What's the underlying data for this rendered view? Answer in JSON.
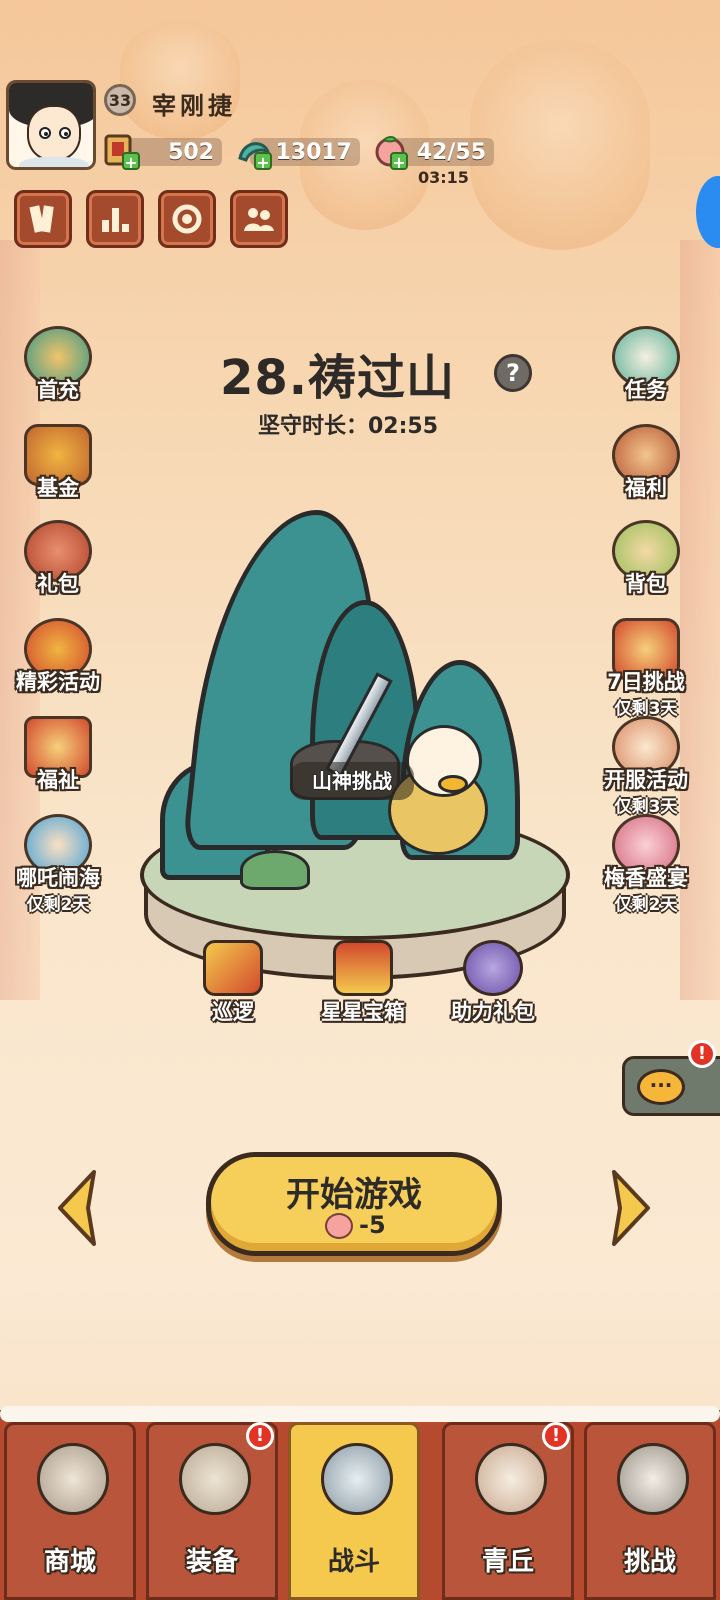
{
  "player": {
    "level": "33",
    "name": "宰刚捷"
  },
  "resources": {
    "scrolls": "502",
    "jade": "13017",
    "stamina": "42/55",
    "stamina_timer": "03:15"
  },
  "top_buttons": [
    {
      "icon": "cards-icon"
    },
    {
      "icon": "ranking-icon"
    },
    {
      "icon": "settings-icon"
    },
    {
      "icon": "friends-icon"
    }
  ],
  "stage": {
    "title": "28.祷过山",
    "hold_time": "坚守时长：02:55",
    "challenge_label": "山神挑战"
  },
  "left_menu": [
    {
      "label": "首充",
      "sub": ""
    },
    {
      "label": "基金",
      "sub": ""
    },
    {
      "label": "礼包",
      "sub": ""
    },
    {
      "label": "精彩活动",
      "sub": ""
    },
    {
      "label": "福祉",
      "sub": ""
    },
    {
      "label": "哪吒闹海",
      "sub": "仅剩2天"
    }
  ],
  "right_menu": [
    {
      "label": "任务",
      "sub": ""
    },
    {
      "label": "福利",
      "sub": ""
    },
    {
      "label": "背包",
      "sub": ""
    },
    {
      "label": "7日挑战",
      "sub": "仅剩3天"
    },
    {
      "label": "开服活动",
      "sub": "仅剩3天"
    },
    {
      "label": "梅香盛宴",
      "sub": "仅剩2天"
    }
  ],
  "scene_items": [
    {
      "label": "巡逻"
    },
    {
      "label": "星星宝箱"
    },
    {
      "label": "助力礼包"
    }
  ],
  "chat": {
    "bubble": "···",
    "alert": "!"
  },
  "start": {
    "label": "开始游戏",
    "cost": "-5"
  },
  "nav": [
    {
      "label": "商城",
      "alert": ""
    },
    {
      "label": "装备",
      "alert": "!"
    },
    {
      "label": "战斗",
      "alert": ""
    },
    {
      "label": "青丘",
      "alert": "!"
    },
    {
      "label": "挑战",
      "alert": ""
    }
  ],
  "colors": {
    "nav_bg": "#b64a2e",
    "nav_active": "#f4c94d",
    "start_button": "#f6cf5a",
    "mountain": "#3b9290"
  }
}
